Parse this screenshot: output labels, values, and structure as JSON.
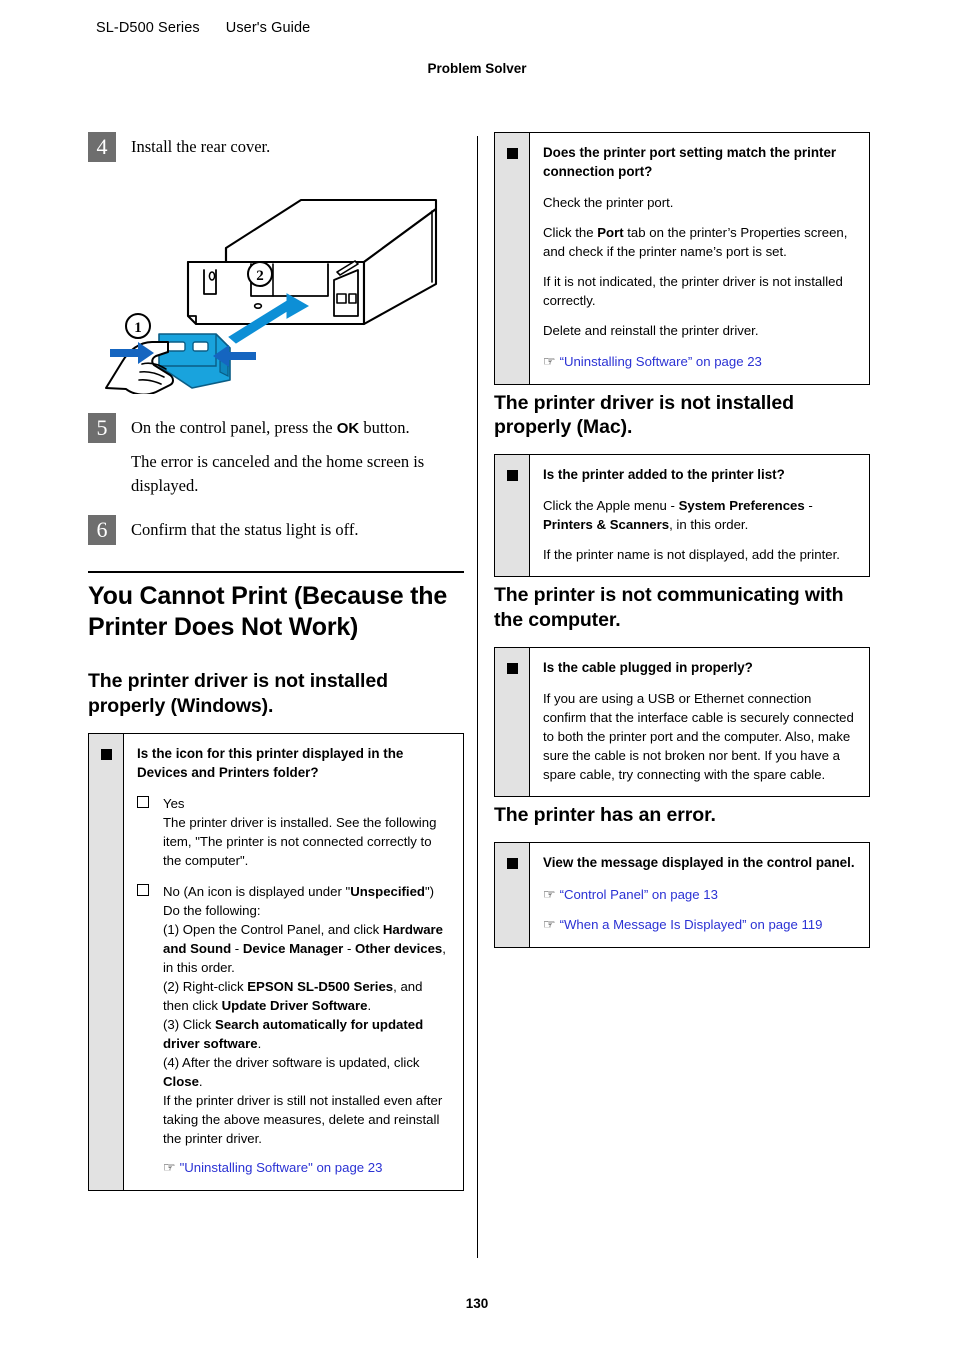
{
  "header": {
    "model": "SL-D500 Series",
    "guide": "User's Guide",
    "chapter": "Problem Solver"
  },
  "footer": {
    "page_number": "130"
  },
  "left_column": {
    "steps": [
      {
        "number": "4",
        "text": "Install the rear cover.",
        "figure": {
          "name": "rear-cover-installation-illustration",
          "callouts": [
            "1",
            "2"
          ]
        }
      },
      {
        "number": "5",
        "text_before_kbd": "On the control panel, press the ",
        "kbd": "OK",
        "text_after_kbd": " button.",
        "note": "The error is canceled and the home screen is displayed."
      },
      {
        "number": "6",
        "text": "Confirm that the status light is off."
      }
    ],
    "section_heading": "You Cannot Print (Because the Printer Does Not Work)",
    "sub_heading": "The printer driver is not installed properly (Windows).",
    "checkbox": {
      "question": "Is the icon for this printer displayed in the Devices and Printers folder?",
      "items": [
        {
          "label": "Yes",
          "body": "The printer driver is installed. See the following item, \"The printer is not connected correctly to the computer\"."
        },
        {
          "label_prefix": "No (An icon is displayed under \"",
          "label_bold": "Unspecified",
          "label_suffix": "\")",
          "intro": "Do the following:",
          "numbered": [
            {
              "t1": "(1) Open the Control Panel, and click ",
              "b1": "Hardware and Sound",
              "t2": " - ",
              "b2": "Device Manager",
              "t3": " - ",
              "b3": "Other devices",
              "t4": ", in this order."
            },
            {
              "t1": "(2) Right-click ",
              "b1": "EPSON SL-D500 Series",
              "t2": ", and then click ",
              "b2": "Update Driver Software",
              "t3": "."
            },
            {
              "t1": "(3) Click ",
              "b1": "Search automatically for updated driver software",
              "t2": "."
            },
            {
              "t1": "(4) After the driver software is updated, click ",
              "b1": "Close",
              "t2": "."
            }
          ],
          "closing": "If the printer driver is still not installed even after taking the above measures, delete and reinstall the printer driver."
        }
      ],
      "link": {
        "icon": "pointing-hand-icon",
        "text": "\"Uninstalling Software\" on page 23"
      }
    }
  },
  "right_column": {
    "checkbox_port": {
      "question": "Does the printer port setting match the printer connection port?",
      "paragraphs": [
        "Check the printer port.",
        "If it is not indicated, the printer driver is not installed correctly.",
        "Delete and reinstall the printer driver."
      ],
      "port_line": {
        "t1": "Click the ",
        "b1": "Port",
        "t2": " tab on the printer’s Properties screen, and check if the printer name’s port is set."
      },
      "link": {
        "icon": "pointing-hand-icon",
        "text": "“Uninstalling Software” on page 23"
      }
    },
    "heading_mac": "The printer driver is not installed properly (Mac).",
    "checkbox_mac": {
      "question": "Is the printer added to the printer list?",
      "apple_line": {
        "t1": "Click the Apple menu - ",
        "b1": "System Preferences",
        "t2": " - ",
        "b2": "Printers & Scanners",
        "t3": ", in this order."
      },
      "paragraph": "If the printer name is not displayed, add the printer."
    },
    "heading_comm": "The printer is not communicating with the computer.",
    "checkbox_cable": {
      "question": "Is the cable plugged in properly?",
      "paragraph": "If you are using a USB or Ethernet connection confirm that the interface cable is securely connected to both the printer port and the computer. Also, make sure the cable is not broken nor bent. If you have a spare cable, try connecting with the spare cable."
    },
    "heading_error": "The printer has an error.",
    "checkbox_error": {
      "question": "View the message displayed in the control panel.",
      "links": [
        {
          "icon": "pointing-hand-icon",
          "text": "“Control Panel” on page 13"
        },
        {
          "icon": "pointing-hand-icon",
          "text": "“When a Message Is Displayed” on page 119"
        }
      ]
    }
  },
  "colors": {
    "link": "#2b32d4",
    "step_box": "#6e6e6e",
    "gutter": "#e2e2e2",
    "illustration_accent": "#00a0e9"
  }
}
